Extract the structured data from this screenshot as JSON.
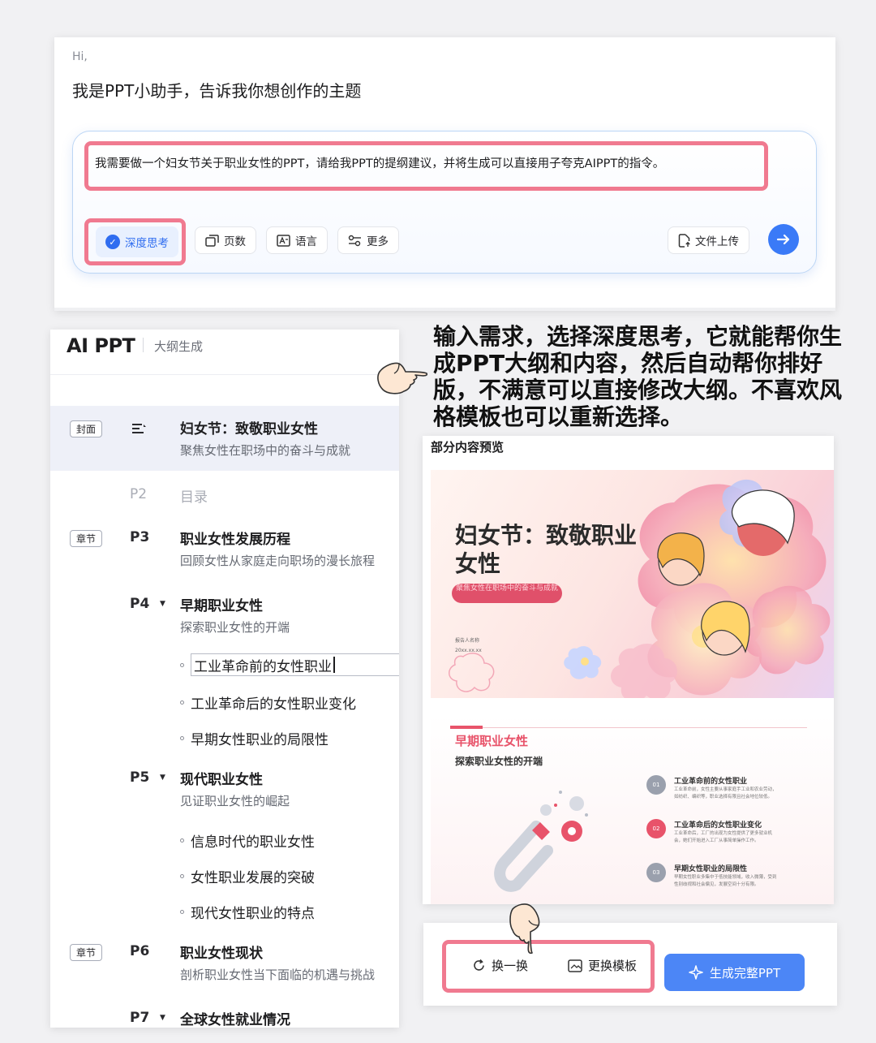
{
  "prompt_card": {
    "greeting": "Hi,",
    "title": "我是PPT小助手，告诉我你想创作的主题",
    "input_text": "我需要做一个妇女节关于职业女性的PPT，请给我PPT的提纲建议，并将生成可以直接用子夸克AIPPT的指令。",
    "options": {
      "deep_think": "深度思考",
      "pages": "页数",
      "language": "语言",
      "more": "更多",
      "upload": "文件上传"
    }
  },
  "outline": {
    "logo": "AI PPT",
    "header_sub": "大纲生成",
    "cover": {
      "tag": "封面",
      "title": "妇女节：致敬职业女性",
      "subtitle": "聚焦女性在职场中的奋斗与成就"
    },
    "p2": {
      "num": "P2",
      "title": "目录"
    },
    "p3": {
      "tag": "章节",
      "num": "P3",
      "title": "职业女性发展历程",
      "subtitle": "回顾女性从家庭走向职场的漫长旅程"
    },
    "p4": {
      "num": "P4",
      "title": "早期职业女性",
      "subtitle": "探索职业女性的开端",
      "bullets": [
        "工业革命前的女性职业",
        "工业革命后的女性职业变化",
        "早期女性职业的局限性"
      ]
    },
    "p5": {
      "num": "P5",
      "title": "现代职业女性",
      "subtitle": "见证职业女性的崛起",
      "bullets": [
        "信息时代的职业女性",
        "女性职业发展的突破",
        "现代女性职业的特点"
      ]
    },
    "p6": {
      "tag": "章节",
      "num": "P6",
      "title": "职业女性现状",
      "subtitle": "剖析职业女性当下面临的机遇与挑战"
    },
    "p7": {
      "num": "P7",
      "title": "全球女性就业情况"
    }
  },
  "annotation": "输入需求，选择深度思考，它就能帮你生成PPT大纲和内容，然后自动帮你排好版，不满意可以直接修改大纲。不喜欢风格模板也可以重新选择。",
  "preview": {
    "title": "部分内容预览",
    "slide1": {
      "title": "妇女节：致敬职业女性",
      "pill": "聚焦女性在职场中的奋斗与成就",
      "meta1": "报告人名称",
      "meta2": "20xx.xx.xx"
    },
    "slide2": {
      "title": "早期职业女性",
      "subtitle": "探索职业女性的开端",
      "items": [
        {
          "num": "01",
          "title": "工业革命前的女性职业",
          "text": "工业革命前，女性主要从事家庭手工业和农业劳动，如纺织、编织等，职业选择有限且社会地位较低。"
        },
        {
          "num": "02",
          "title": "工业革命后的女性职业变化",
          "text": "工业革命后，工厂的出现为女性提供了更多就业机会，她们开始进入工厂从事简单操作工作。"
        },
        {
          "num": "03",
          "title": "早期女性职业的局限性",
          "text": "早期女性职业多集中于低技能领域，收入微薄，受到性别歧视和社会偏见，发展空间十分有限。"
        }
      ]
    }
  },
  "actions": {
    "shuffle": "换一换",
    "change_template": "更换模板",
    "generate": "生成完整PPT"
  },
  "colors": {
    "highlight_frame": "#f07a90",
    "primary_blue": "#3a7af7",
    "slide_accent": "#e8536a"
  }
}
